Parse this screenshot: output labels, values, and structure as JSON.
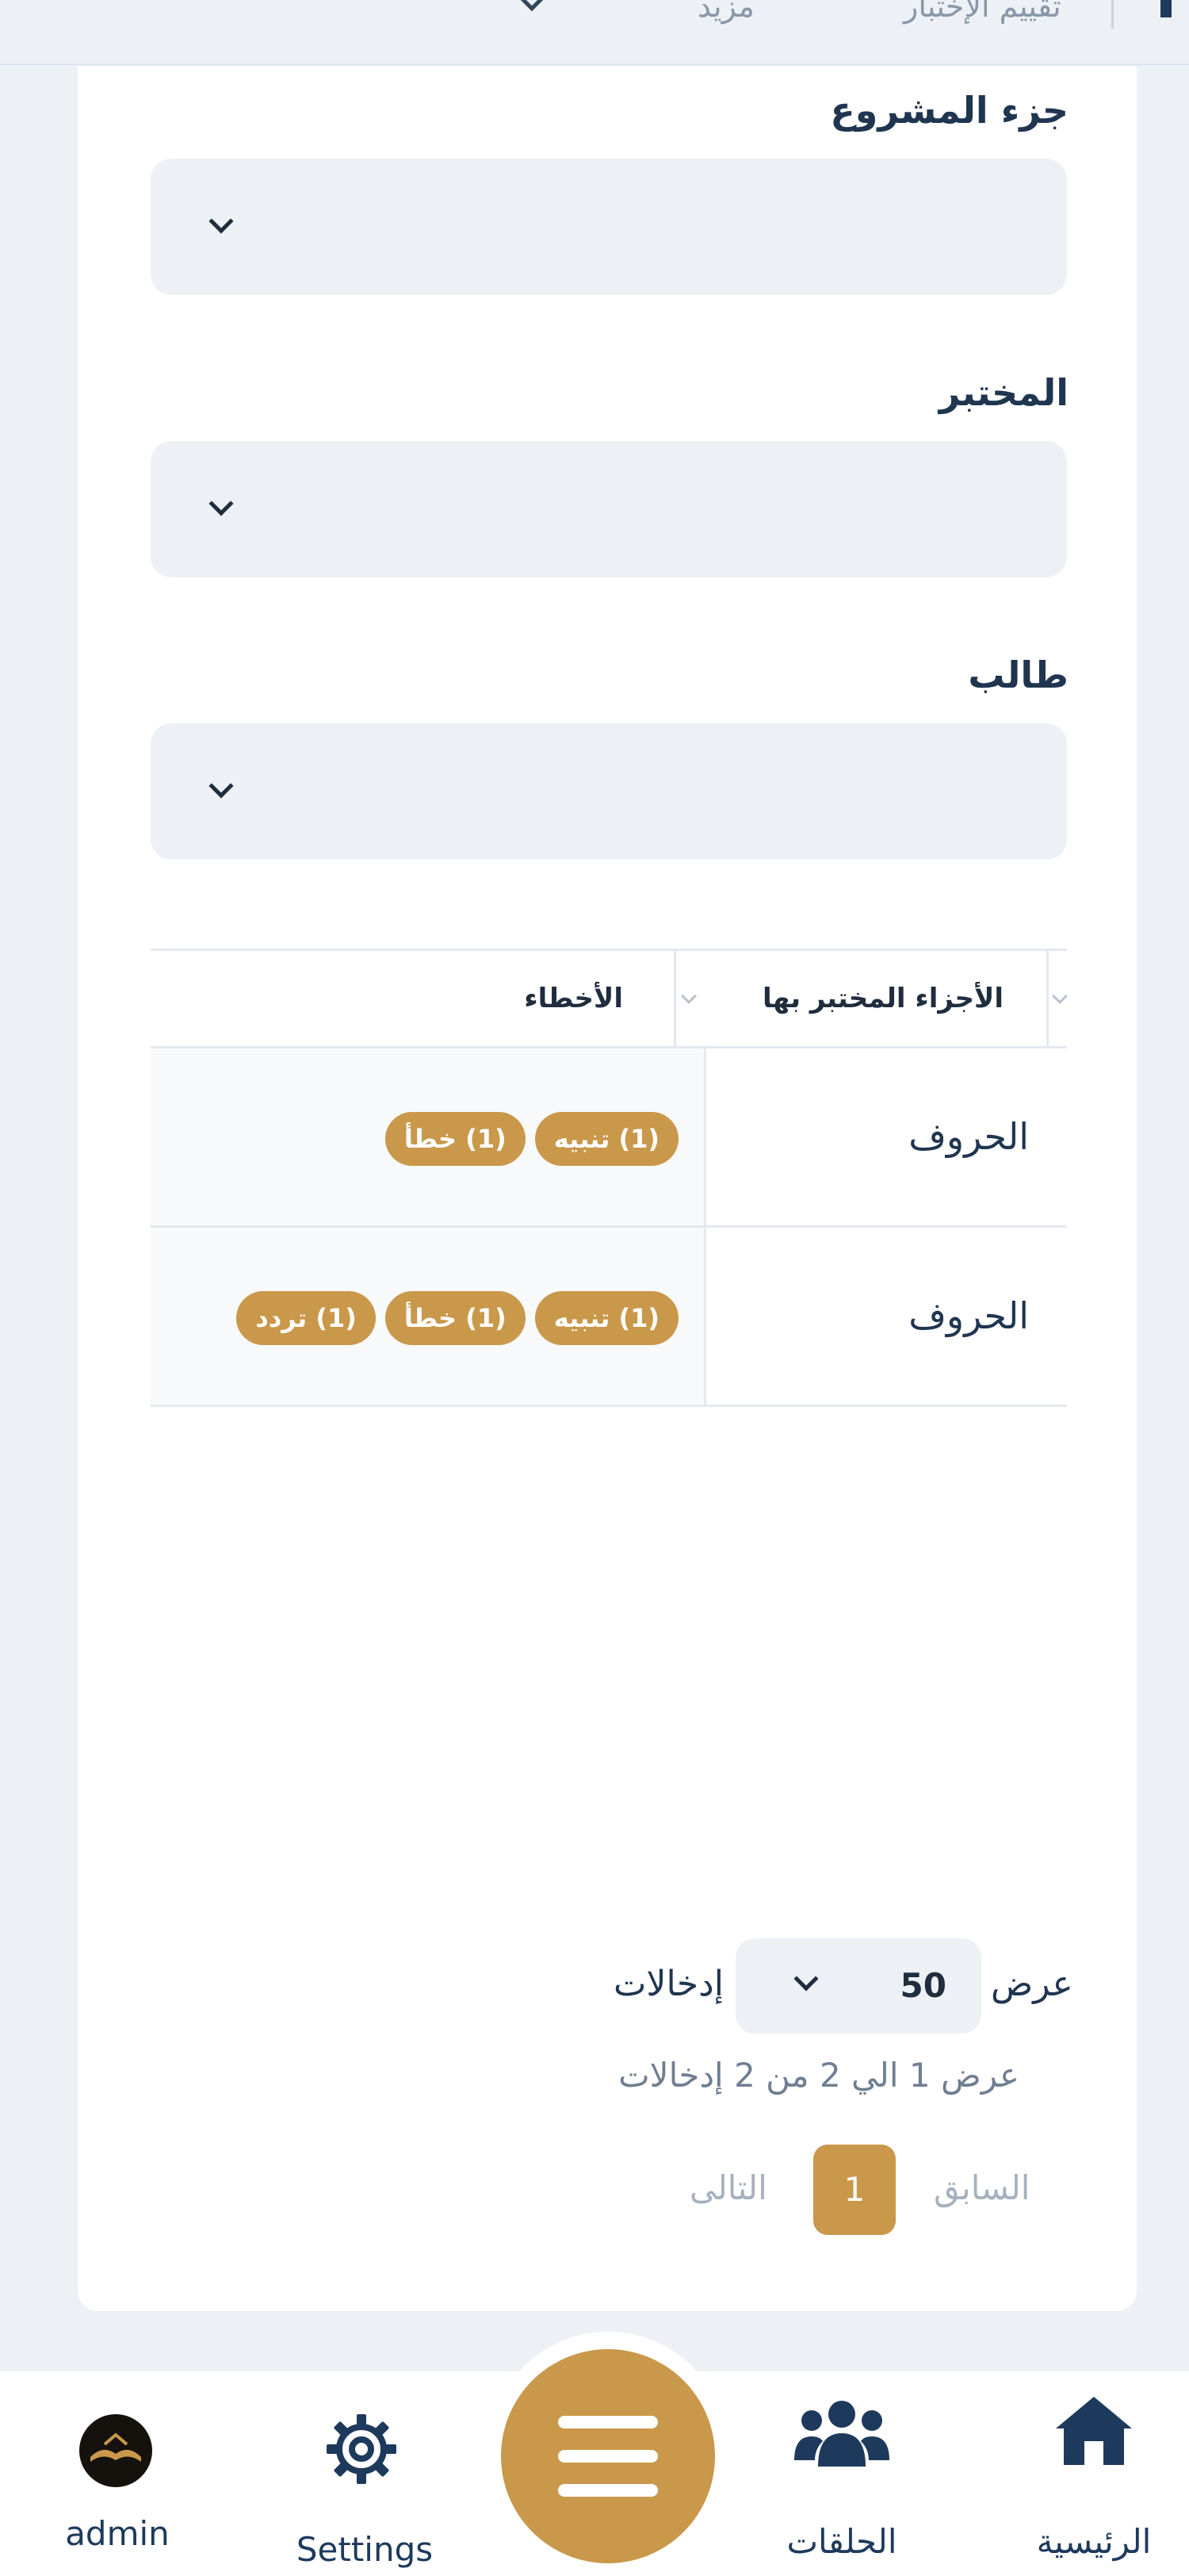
{
  "header": {
    "item_right": "تقييم الإختبار",
    "item_left": "مزيد"
  },
  "form": {
    "project_part_label": "جزء المشروع",
    "tester_label": "المختبر",
    "student_label": "طالب"
  },
  "table": {
    "columns": [
      "الأجزاء المختبر بها",
      "الأخطاء"
    ],
    "rows": [
      {
        "part": "الحروف",
        "badges": [
          "(1) تنبيه",
          "(1) خطأ"
        ]
      },
      {
        "part": "الحروف",
        "badges": [
          "(1) تنبيه",
          "(1) خطأ",
          "(1) تردد"
        ]
      }
    ]
  },
  "length": {
    "show": "عرض",
    "value": "50",
    "entries": "إدخالات"
  },
  "info": "عرض 1 الي 2 من 2 إدخالات",
  "pagination": {
    "previous": "السابق",
    "current": "1",
    "next": "التالى"
  },
  "bottom_nav": {
    "home": "الرئيسية",
    "circles": "الحلقات",
    "settings": "Settings",
    "admin": "admin"
  },
  "colors": {
    "accent": "#c9984a",
    "navy": "#1d3a5c",
    "background": "#edf1f5"
  }
}
